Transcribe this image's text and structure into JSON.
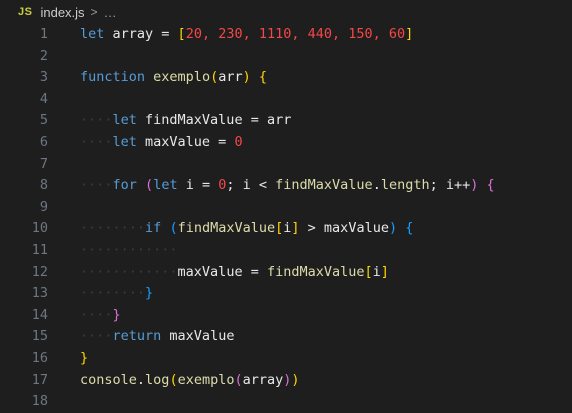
{
  "breadcrumb": {
    "icon_label": "JS",
    "file_name": "index.js",
    "separator": ">",
    "more": "…"
  },
  "editor": {
    "lines": [
      {
        "num": "1",
        "tokens": [
          [
            "kw",
            "let"
          ],
          [
            "plain",
            " array = "
          ],
          [
            "b1",
            "["
          ],
          [
            "red",
            "20, 230, 1110, 440, 150, 60"
          ],
          [
            "b1",
            "]"
          ]
        ]
      },
      {
        "num": "2",
        "tokens": []
      },
      {
        "num": "3",
        "tokens": [
          [
            "kw",
            "function"
          ],
          [
            "plain",
            " "
          ],
          [
            "fname",
            "exemplo"
          ],
          [
            "b1",
            "("
          ],
          [
            "plain",
            "arr"
          ],
          [
            "b1",
            ")"
          ],
          [
            "plain",
            " "
          ],
          [
            "b1",
            "{"
          ]
        ]
      },
      {
        "num": "4",
        "tokens": []
      },
      {
        "num": "5",
        "tokens": [
          [
            "ws",
            "····"
          ],
          [
            "kw",
            "let"
          ],
          [
            "plain",
            " findMaxValue = arr"
          ]
        ]
      },
      {
        "num": "6",
        "tokens": [
          [
            "ws",
            "····"
          ],
          [
            "kw",
            "let"
          ],
          [
            "plain",
            " maxValue = "
          ],
          [
            "red",
            "0"
          ]
        ]
      },
      {
        "num": "7",
        "tokens": []
      },
      {
        "num": "8",
        "tokens": [
          [
            "ws",
            "····"
          ],
          [
            "kw",
            "for"
          ],
          [
            "plain",
            " "
          ],
          [
            "b2",
            "("
          ],
          [
            "kw",
            "let"
          ],
          [
            "plain",
            " i = "
          ],
          [
            "red",
            "0"
          ],
          [
            "plain",
            "; i < "
          ],
          [
            "fname",
            "findMaxValue"
          ],
          [
            "plain",
            "."
          ],
          [
            "fname",
            "length"
          ],
          [
            "plain",
            "; i++"
          ],
          [
            "b2",
            ")"
          ],
          [
            "plain",
            " "
          ],
          [
            "b2",
            "{"
          ]
        ]
      },
      {
        "num": "9",
        "tokens": []
      },
      {
        "num": "10",
        "tokens": [
          [
            "ws",
            "········"
          ],
          [
            "kw",
            "if"
          ],
          [
            "plain",
            " "
          ],
          [
            "b3",
            "("
          ],
          [
            "fname",
            "findMaxValue"
          ],
          [
            "b1",
            "["
          ],
          [
            "plain",
            "i"
          ],
          [
            "b1",
            "]"
          ],
          [
            "plain",
            " > maxValue"
          ],
          [
            "b3",
            ")"
          ],
          [
            "plain",
            " "
          ],
          [
            "b3",
            "{"
          ]
        ]
      },
      {
        "num": "11",
        "tokens": [
          [
            "ws",
            "············"
          ]
        ]
      },
      {
        "num": "12",
        "tokens": [
          [
            "ws",
            "············"
          ],
          [
            "plain",
            "maxValue = "
          ],
          [
            "fname",
            "findMaxValue"
          ],
          [
            "b1",
            "["
          ],
          [
            "plain",
            "i"
          ],
          [
            "b1",
            "]"
          ]
        ]
      },
      {
        "num": "13",
        "tokens": [
          [
            "ws",
            "········"
          ],
          [
            "b3",
            "}"
          ]
        ]
      },
      {
        "num": "14",
        "tokens": [
          [
            "ws",
            "····"
          ],
          [
            "b2",
            "}"
          ]
        ]
      },
      {
        "num": "15",
        "tokens": [
          [
            "ws",
            "····"
          ],
          [
            "kw",
            "return"
          ],
          [
            "plain",
            " maxValue"
          ]
        ]
      },
      {
        "num": "16",
        "tokens": [
          [
            "b1",
            "}"
          ]
        ]
      },
      {
        "num": "17",
        "tokens": [
          [
            "fname",
            "console"
          ],
          [
            "plain",
            "."
          ],
          [
            "fname",
            "log"
          ],
          [
            "b1",
            "("
          ],
          [
            "fname",
            "exemplo"
          ],
          [
            "b2",
            "("
          ],
          [
            "plain",
            "array"
          ],
          [
            "b2",
            ")"
          ],
          [
            "b1",
            ")"
          ]
        ]
      },
      {
        "num": "18",
        "tokens": []
      }
    ]
  }
}
